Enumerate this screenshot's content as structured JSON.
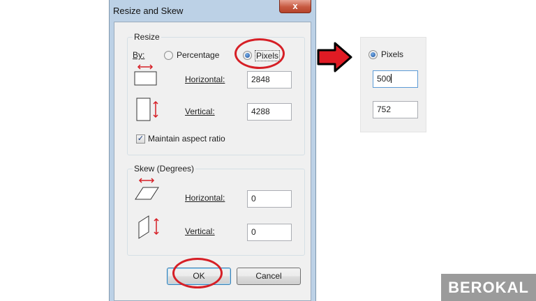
{
  "dialog": {
    "title": "Resize and Skew",
    "close_glyph": "x",
    "resize": {
      "group_label": "Resize",
      "by_label": "By:",
      "percentage_label": "Percentage",
      "pixels_label": "Pixels",
      "selected_unit": "Pixels",
      "horizontal_label": "Horizontal:",
      "horizontal_value": "2848",
      "vertical_label": "Vertical:",
      "vertical_value": "4288",
      "maintain_label": "Maintain aspect ratio",
      "maintain_checked": true
    },
    "skew": {
      "group_label": "Skew (Degrees)",
      "horizontal_label": "Horizontal:",
      "horizontal_value": "0",
      "vertical_label": "Vertical:",
      "vertical_value": "0"
    },
    "ok_label": "OK",
    "cancel_label": "Cancel"
  },
  "excerpt": {
    "pixels_label": "Pixels",
    "horizontal_value": "500",
    "vertical_value": "752"
  },
  "colors": {
    "highlight": "#d61f26",
    "arrow_fill": "#e01b24",
    "watermark_bg": "#9b9b9b"
  },
  "icons": {
    "close": "close-icon",
    "arrow": "right-arrow-icon"
  },
  "watermark": "BEROKAL"
}
